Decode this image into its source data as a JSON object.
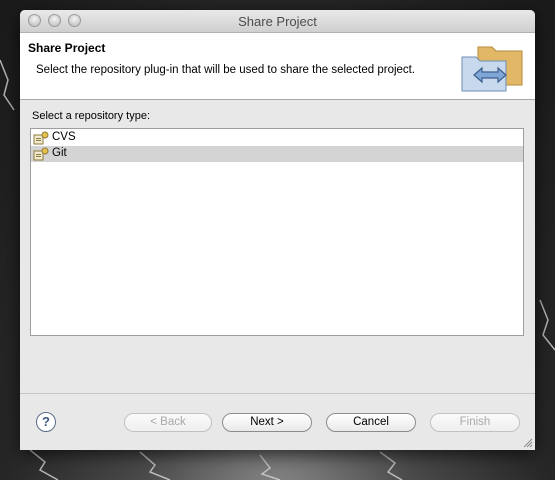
{
  "window": {
    "title": "Share Project"
  },
  "banner": {
    "title": "Share Project",
    "description": "Select the repository plug-in that will be used to share the selected project."
  },
  "main": {
    "label": "Select a repository type:",
    "items": [
      {
        "label": "CVS",
        "icon": "repository-plugin-icon",
        "selected": false
      },
      {
        "label": "Git",
        "icon": "repository-plugin-icon",
        "selected": true
      }
    ]
  },
  "footer": {
    "help_label": "?",
    "back_label": "< Back",
    "next_label": "Next >",
    "cancel_label": "Cancel",
    "finish_label": "Finish"
  }
}
